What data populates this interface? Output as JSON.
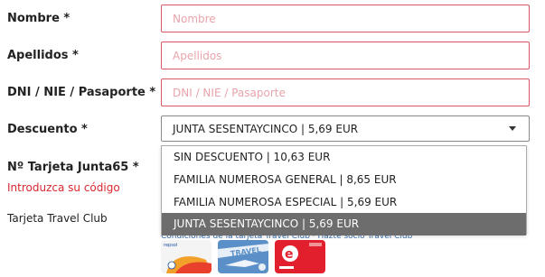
{
  "form": {
    "nombre": {
      "label": "Nombre *",
      "placeholder": "Nombre"
    },
    "apellidos": {
      "label": "Apellidos *",
      "placeholder": "Apellidos"
    },
    "documento": {
      "label": "DNI / NIE / Pasaporte *",
      "placeholder": "DNI / NIE / Pasaporte"
    },
    "descuento": {
      "label": "Descuento *",
      "selected": "JUNTA SESENTAYCINCO  |  5,69 EUR",
      "options": [
        "SIN DESCUENTO  |  10,63 EUR",
        "FAMILIA NUMEROSA GENERAL  |  8,65 EUR",
        "FAMILIA NUMEROSA ESPECIAL  |  5,69 EUR",
        "JUNTA SESENTAYCINCO  |  5,69 EUR"
      ]
    },
    "tarjeta_junta": {
      "label": "Nº Tarjeta Junta65 *",
      "error": "Introduzca su código"
    },
    "travel_club": {
      "label": "Tarjeta Travel Club",
      "links": "Condiciones de la tarjeta Travel Club  ·  Hazte socio Travel Club"
    }
  },
  "colors": {
    "error_border": "#d65a65",
    "error_text": "#d9282f",
    "placeholder": "#e8a4ab",
    "selected_option_bg": "#6d6d6d"
  },
  "icons": [
    "chevron-down-icon",
    "repsol-card-icon",
    "travel-club-card-icon",
    "eroski-card-icon"
  ]
}
